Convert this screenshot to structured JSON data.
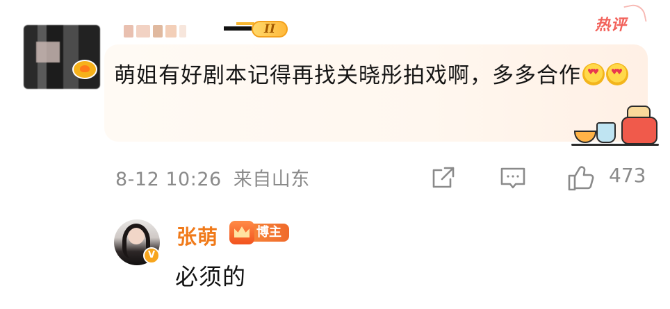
{
  "comment": {
    "hot_tag": "热评",
    "level_badge": "II",
    "text": "萌姐有好剧本记得再找关晓彤拍戏啊，多多合作",
    "emojis": [
      "heart-eyes-emoji",
      "heart-eyes-emoji"
    ],
    "timestamp": "8-12 10:26",
    "location": "来自山东",
    "like_count": "473"
  },
  "reply": {
    "author": "张萌",
    "author_tag": "博主",
    "verified_mark": "V",
    "text": "必须的"
  },
  "colors": {
    "hot_tag": "#f2625b",
    "reply_name": "#f07a1a",
    "bubble_bg": "#fff7ef",
    "meta_text": "#8a8a8a"
  }
}
